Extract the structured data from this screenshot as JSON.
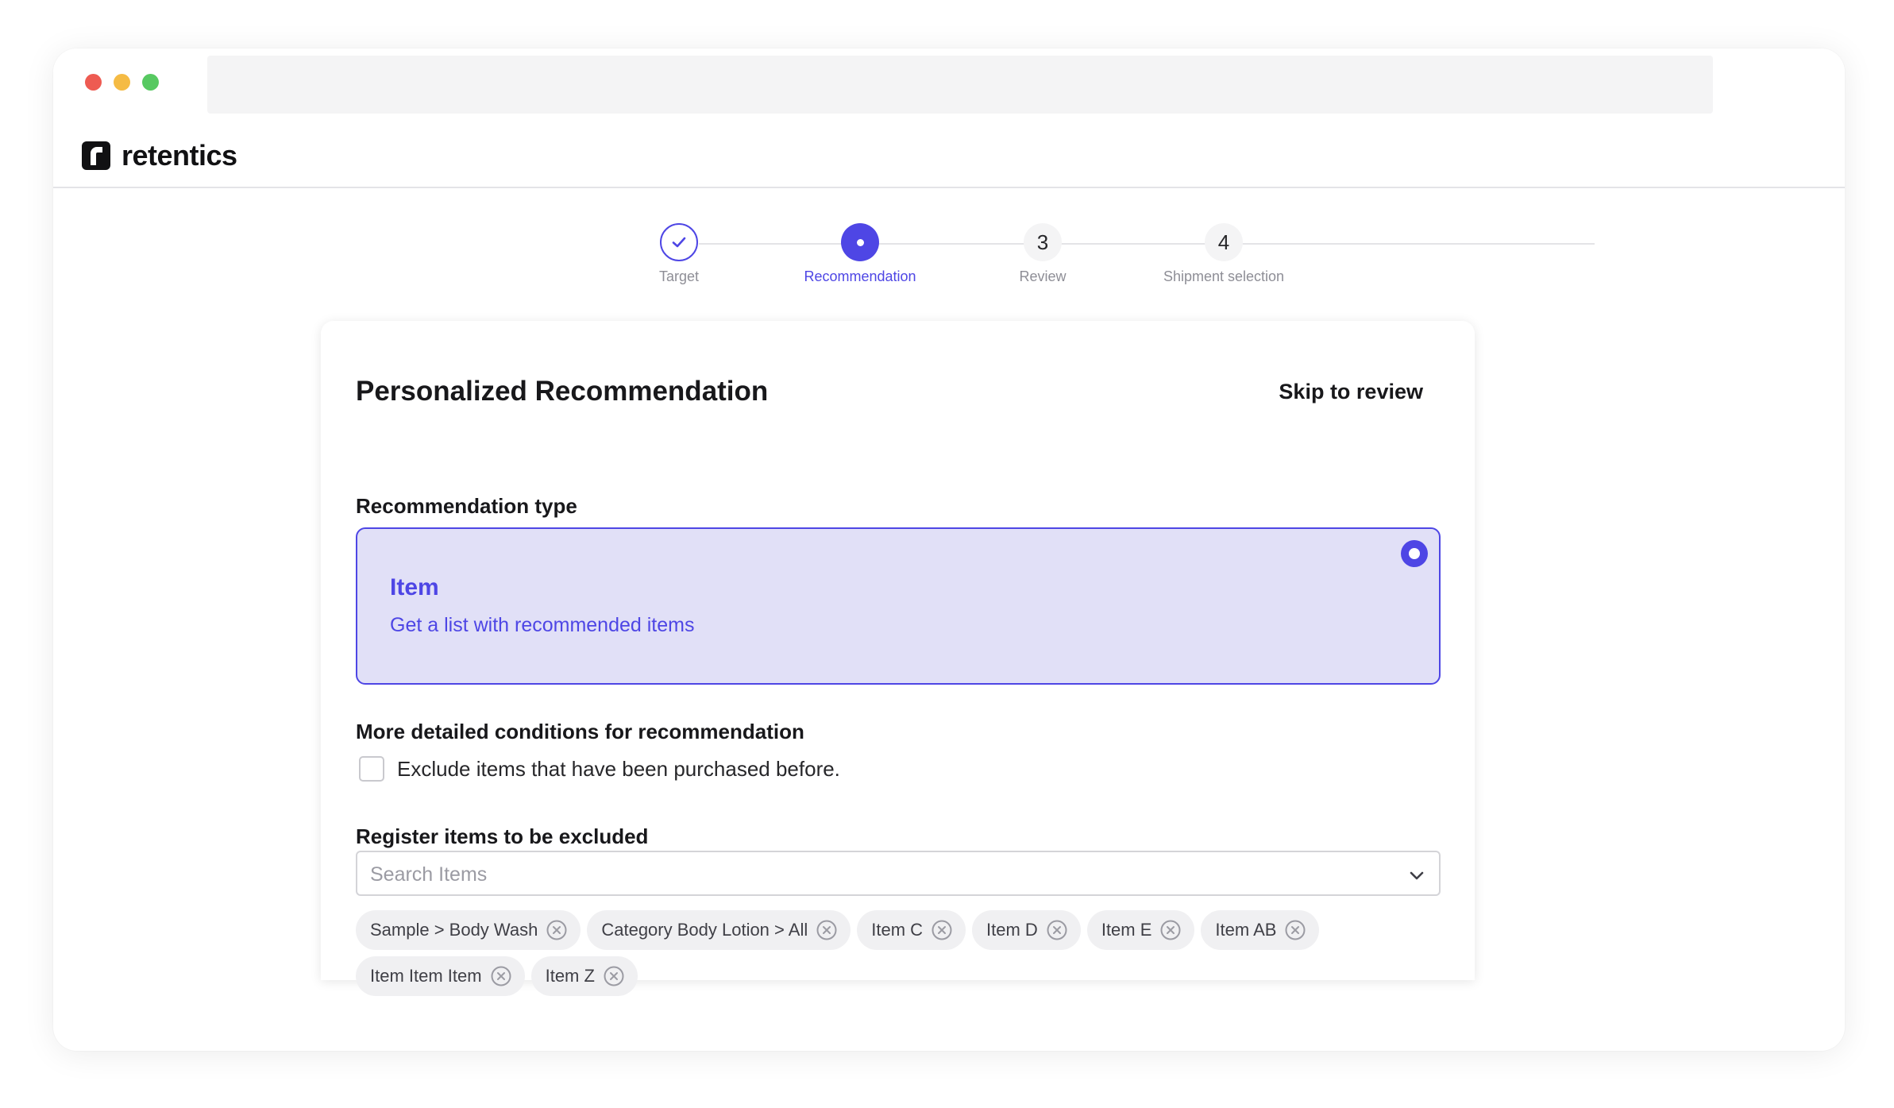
{
  "app": {
    "brand": "retentics"
  },
  "stepper": {
    "steps": [
      {
        "number": "",
        "label": "Target",
        "state": "done"
      },
      {
        "number": "",
        "label": "Recommendation",
        "state": "active"
      },
      {
        "number": "3",
        "label": "Review",
        "state": "pending"
      },
      {
        "number": "4",
        "label": "Shipment selection",
        "state": "pending"
      }
    ]
  },
  "card": {
    "title": "Personalized Recommendation",
    "skip_label": "Skip to review",
    "rec_type_label": "Recommendation type",
    "option": {
      "title": "Item",
      "description": "Get a list with recommended items",
      "selected": true
    },
    "conditions_label": "More detailed conditions for recommendation",
    "exclude_purchased_label": "Exclude items that have been purchased before.",
    "exclude_purchased_checked": false,
    "exclude_label": "Register items to be excluded",
    "search_placeholder": "Search Items",
    "chips": [
      "Sample > Body Wash",
      "Category Body Lotion > All",
      "Item C",
      "Item D",
      "Item E",
      "Item AB",
      "Item Item Item",
      "Item Z"
    ]
  },
  "colors": {
    "accent": "#4e46e5",
    "accent_bg": "#e1e0f7"
  }
}
